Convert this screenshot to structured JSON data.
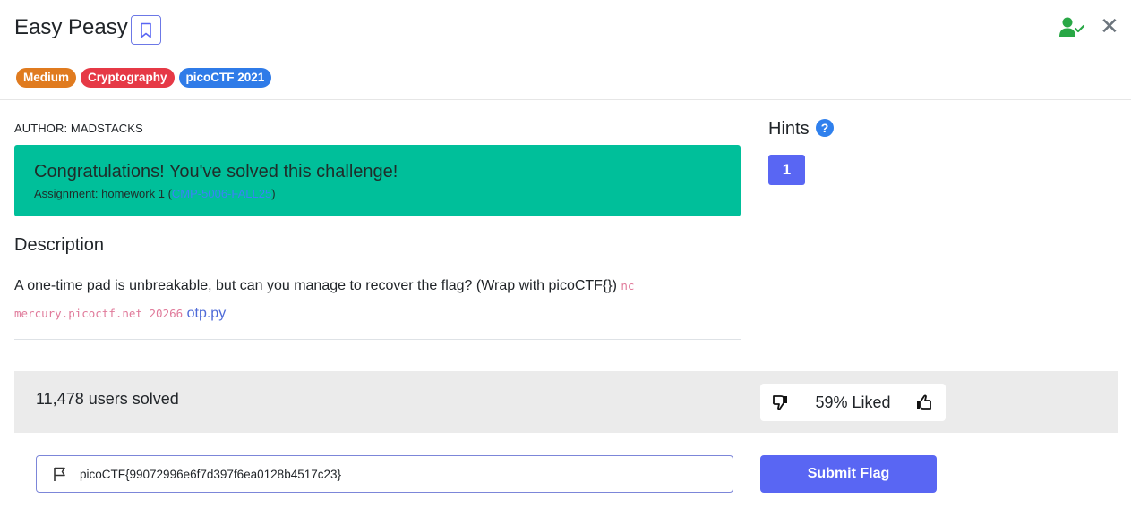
{
  "challenge": {
    "title": "Easy Peasy",
    "tags": [
      {
        "label": "Medium",
        "color": "#e07b1f"
      },
      {
        "label": "Cryptography",
        "color": "#e63946"
      },
      {
        "label": "picoCTF 2021",
        "color": "#2f7be8"
      }
    ],
    "author": "AUTHOR: MADSTACKS"
  },
  "success": {
    "heading": "Congratulations! You've solved this challenge!",
    "assignment_prefix": "Assignment: homework 1 (",
    "assignment_link": "CMP-5006-FALL25",
    "assignment_suffix": ")"
  },
  "description": {
    "heading": "Description",
    "text": "A one-time pad is unbreakable, but can you manage to recover the flag? (Wrap with picoCTF{}) ",
    "code_1": "nc",
    "code_2": "mercury.picoctf.net 20266",
    "link": "otp.py"
  },
  "hints": {
    "heading": "Hints",
    "help_glyph": "?",
    "buttons": [
      "1"
    ]
  },
  "stats": {
    "solved": "11,478 users solved",
    "liked": "59% Liked"
  },
  "flag": {
    "value": "picoCTF{99072996e6f7d397f6ea0128b4517c23}",
    "submit_label": "Submit Flag"
  },
  "colors": {
    "success_bg": "#00bf9a",
    "primary": "#5966f3",
    "user_icon": "#28a745"
  },
  "icons": [
    "bookmark-icon",
    "user-check-icon",
    "close-icon",
    "help-icon",
    "thumbs-down-icon",
    "thumbs-up-icon",
    "flag-icon"
  ]
}
